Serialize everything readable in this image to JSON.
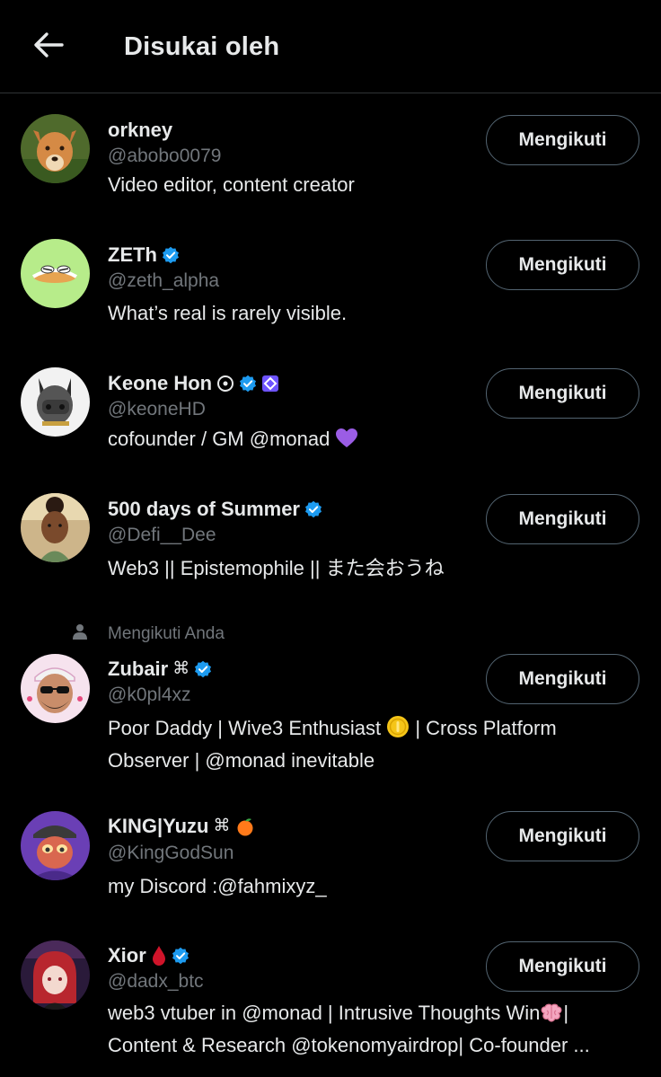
{
  "header": {
    "title": "Disukai oleh",
    "back_icon": "arrow-left-icon"
  },
  "colors": {
    "background": "#000000",
    "text": "#e7e9ea",
    "muted": "#71767b",
    "verified": "#1d9bf0",
    "button_border": "#536471"
  },
  "users": [
    {
      "name": "orkney",
      "handle": "@abobo0079",
      "bio": "Video editor, content creator",
      "button": "Mengikuti",
      "badges": []
    },
    {
      "name": "ZETh",
      "handle": "@zeth_alpha",
      "bio": "What’s real is rarely visible.",
      "button": "Mengikuti",
      "badges": [
        "verified-badge-icon"
      ]
    },
    {
      "name": "Keone Hon",
      "handle": "@keoneHD",
      "bio": "cofounder / GM @monad",
      "bio_emoji": "purple-heart-icon",
      "button": "Mengikuti",
      "badges": [
        "circle-dot-icon",
        "verified-badge-icon",
        "affiliate-badge-icon"
      ]
    },
    {
      "name": "500 days of Summer",
      "handle": "@Defi__Dee",
      "bio": "Web3 || Epistemophile || また会おうね",
      "button": "Mengikuti",
      "badges": [
        "verified-badge-icon"
      ]
    },
    {
      "social_context": "Mengikuti Anda",
      "name": "Zubair",
      "name_suffix": "⌘",
      "handle": "@k0pl4xz",
      "bio_line1_a": "Poor Daddy | Wive3 Enthusiast",
      "bio_line1_b": "| Cross Platform",
      "bio_line2": "Observer | @monad inevitable",
      "bio_emoji": "coin-icon",
      "button": "Mengikuti",
      "badges": [
        "verified-badge-icon"
      ]
    },
    {
      "name": "KING|Yuzu",
      "name_suffix": "⌘",
      "handle": "@KingGodSun",
      "bio": "my Discord :@fahmixyz_",
      "button": "Mengikuti",
      "badges": [
        "tangerine-icon"
      ]
    },
    {
      "name": "Xior",
      "handle": "@dadx_btc",
      "bio_line1": "web3 vtuber in @monad | Intrusive Thoughts Win",
      "bio_line1_end": "|",
      "bio_line2": "Content & Research @tokenomyairdrop| Co-founder ...",
      "bio_emoji": "brain-icon",
      "button": "Mengikuti",
      "badges": [
        "blood-drop-icon",
        "verified-badge-icon"
      ]
    }
  ]
}
